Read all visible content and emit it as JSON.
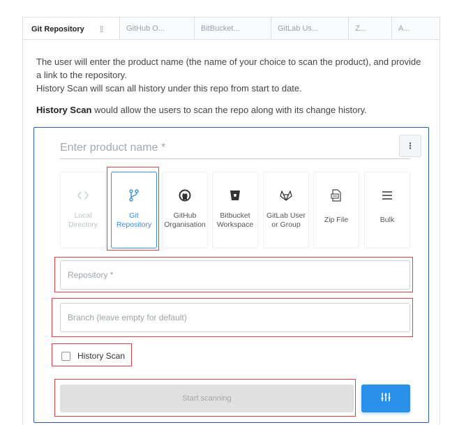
{
  "tabs": [
    {
      "label": "Git Repository",
      "active": true
    },
    {
      "label": "GitHub O..."
    },
    {
      "label": "BitBucket..."
    },
    {
      "label": "GitLab Us..."
    },
    {
      "label": "Z..."
    },
    {
      "label": "A..."
    }
  ],
  "description": {
    "line1": "The user will enter the product name (the name of your choice to scan the product), and provide a link to the repository.",
    "line2": "History Scan will scan all history under this repo from start to date.",
    "history_bold": "History Scan",
    "history_rest": " would allow the users to scan the repo along with its change history."
  },
  "form": {
    "product_placeholder": "Enter product name *",
    "kebab_label": "⋮",
    "sources": [
      {
        "line1": "Local",
        "line2": "Directory",
        "icon": "code-brackets-icon",
        "state": "disabled"
      },
      {
        "line1": "Git",
        "line2": "Repository",
        "icon": "git-branch-icon",
        "state": "selected"
      },
      {
        "line1": "GitHub",
        "line2": "Organisation",
        "icon": "github-icon",
        "state": "normal"
      },
      {
        "line1": "Bitbucket",
        "line2": "Workspace",
        "icon": "bitbucket-icon",
        "state": "normal"
      },
      {
        "line1": "GitLab User",
        "line2": "or Group",
        "icon": "gitlab-icon",
        "state": "normal"
      },
      {
        "line1": "Zip File",
        "line2": "",
        "icon": "zip-file-icon",
        "state": "normal"
      },
      {
        "line1": "Bulk",
        "line2": "",
        "icon": "list-icon",
        "state": "normal"
      }
    ],
    "repository_placeholder": "Repository *",
    "branch_placeholder": "Branch (leave empty for default)",
    "history_checkbox_label": "History Scan",
    "start_button_label": "Start scanning"
  },
  "colors": {
    "accent": "#2a91ea",
    "selected": "#3d8fe0",
    "card_border": "#2f5f9e",
    "highlight": "#d9424b"
  }
}
